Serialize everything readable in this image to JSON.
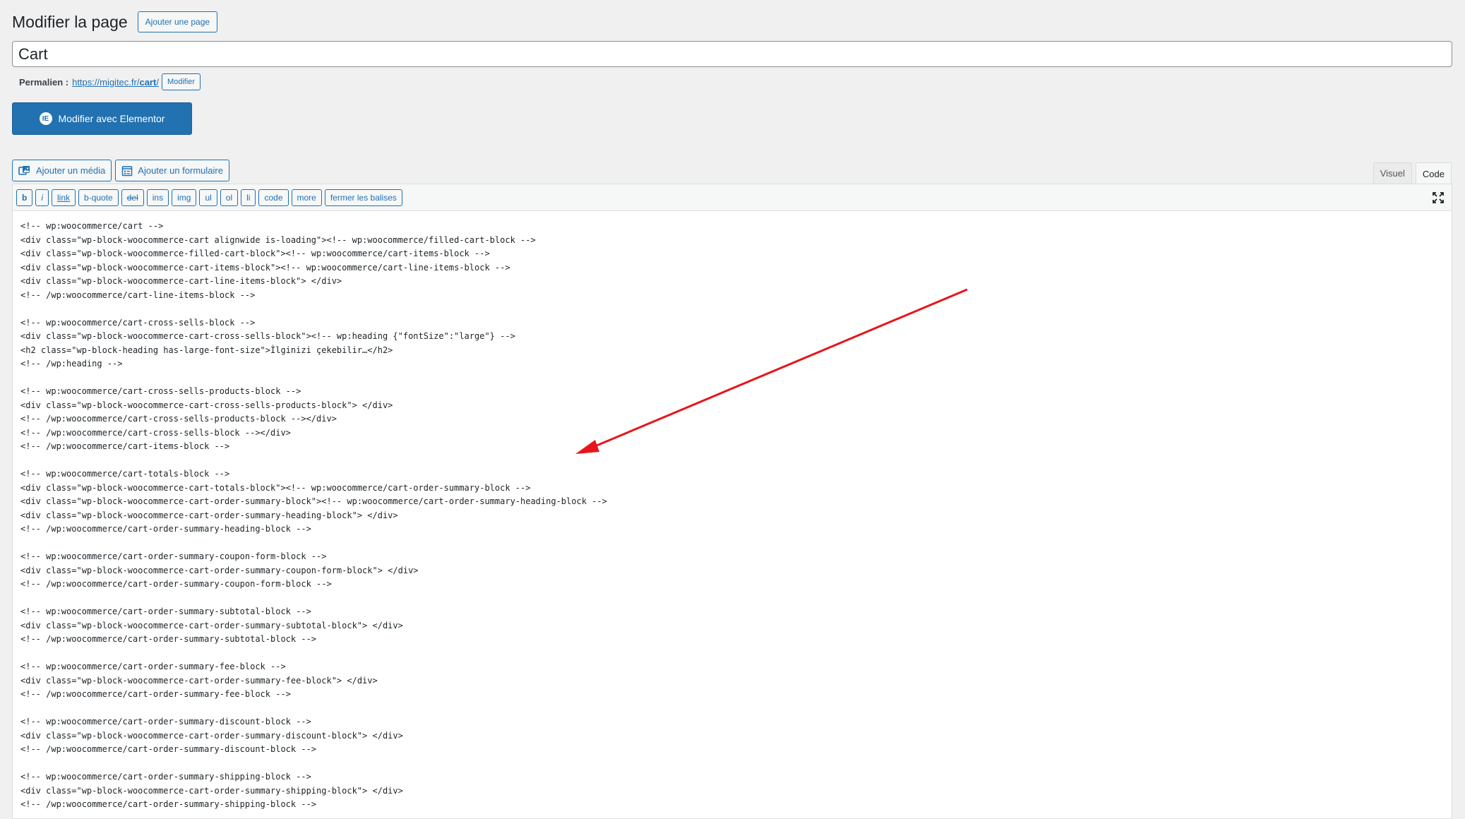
{
  "header": {
    "title": "Modifier la page",
    "add_page_label": "Ajouter une page"
  },
  "post_title": {
    "value": "Cart"
  },
  "permalink": {
    "label": "Permalien :",
    "url_prefix": "https://migitec.fr/",
    "url_slug": "cart",
    "url_suffix": "/",
    "edit_label": "Modifier"
  },
  "elementor": {
    "icon_glyph": "IE",
    "label": "Modifier avec Elementor"
  },
  "media_buttons": {
    "add_media": "Ajouter un média",
    "add_form": "Ajouter un formulaire"
  },
  "editor_tabs": {
    "visual": "Visuel",
    "code": "Code",
    "active": "code"
  },
  "quicktags": [
    "b",
    "i",
    "link",
    "b-quote",
    "del",
    "ins",
    "img",
    "ul",
    "ol",
    "li",
    "code",
    "more",
    "fermer les balises"
  ],
  "code_lines": [
    "<!-- wp:woocommerce/cart -->",
    "<div class=\"wp-block-woocommerce-cart alignwide is-loading\"><!-- wp:woocommerce/filled-cart-block -->",
    "<div class=\"wp-block-woocommerce-filled-cart-block\"><!-- wp:woocommerce/cart-items-block -->",
    "<div class=\"wp-block-woocommerce-cart-items-block\"><!-- wp:woocommerce/cart-line-items-block -->",
    "<div class=\"wp-block-woocommerce-cart-line-items-block\"> </div>",
    "<!-- /wp:woocommerce/cart-line-items-block -->",
    "",
    "<!-- wp:woocommerce/cart-cross-sells-block -->",
    "<div class=\"wp-block-woocommerce-cart-cross-sells-block\"><!-- wp:heading {\"fontSize\":\"large\"} -->",
    "<h2 class=\"wp-block-heading has-large-font-size\">İlginizi çekebilir…</h2>",
    "<!-- /wp:heading -->",
    "",
    "<!-- wp:woocommerce/cart-cross-sells-products-block -->",
    "<div class=\"wp-block-woocommerce-cart-cross-sells-products-block\"> </div>",
    "<!-- /wp:woocommerce/cart-cross-sells-products-block --></div>",
    "<!-- /wp:woocommerce/cart-cross-sells-block --></div>",
    "<!-- /wp:woocommerce/cart-items-block -->",
    "",
    "<!-- wp:woocommerce/cart-totals-block -->",
    "<div class=\"wp-block-woocommerce-cart-totals-block\"><!-- wp:woocommerce/cart-order-summary-block -->",
    "<div class=\"wp-block-woocommerce-cart-order-summary-block\"><!-- wp:woocommerce/cart-order-summary-heading-block -->",
    "<div class=\"wp-block-woocommerce-cart-order-summary-heading-block\"> </div>",
    "<!-- /wp:woocommerce/cart-order-summary-heading-block -->",
    "",
    "<!-- wp:woocommerce/cart-order-summary-coupon-form-block -->",
    "<div class=\"wp-block-woocommerce-cart-order-summary-coupon-form-block\"> </div>",
    "<!-- /wp:woocommerce/cart-order-summary-coupon-form-block -->",
    "",
    "<!-- wp:woocommerce/cart-order-summary-subtotal-block -->",
    "<div class=\"wp-block-woocommerce-cart-order-summary-subtotal-block\"> </div>",
    "<!-- /wp:woocommerce/cart-order-summary-subtotal-block -->",
    "",
    "<!-- wp:woocommerce/cart-order-summary-fee-block -->",
    "<div class=\"wp-block-woocommerce-cart-order-summary-fee-block\"> </div>",
    "<!-- /wp:woocommerce/cart-order-summary-fee-block -->",
    "",
    "<!-- wp:woocommerce/cart-order-summary-discount-block -->",
    "<div class=\"wp-block-woocommerce-cart-order-summary-discount-block\"> </div>",
    "<!-- /wp:woocommerce/cart-order-summary-discount-block -->",
    "",
    "<!-- wp:woocommerce/cart-order-summary-shipping-block -->",
    "<div class=\"wp-block-woocommerce-cart-order-summary-shipping-block\"> </div>",
    "<!-- /wp:woocommerce/cart-order-summary-shipping-block -->"
  ],
  "annotation": {
    "color": "#e8141c",
    "icon": "red-arrow-annotation"
  },
  "colors": {
    "accent": "#2271b1",
    "background": "#f0f0f1"
  }
}
